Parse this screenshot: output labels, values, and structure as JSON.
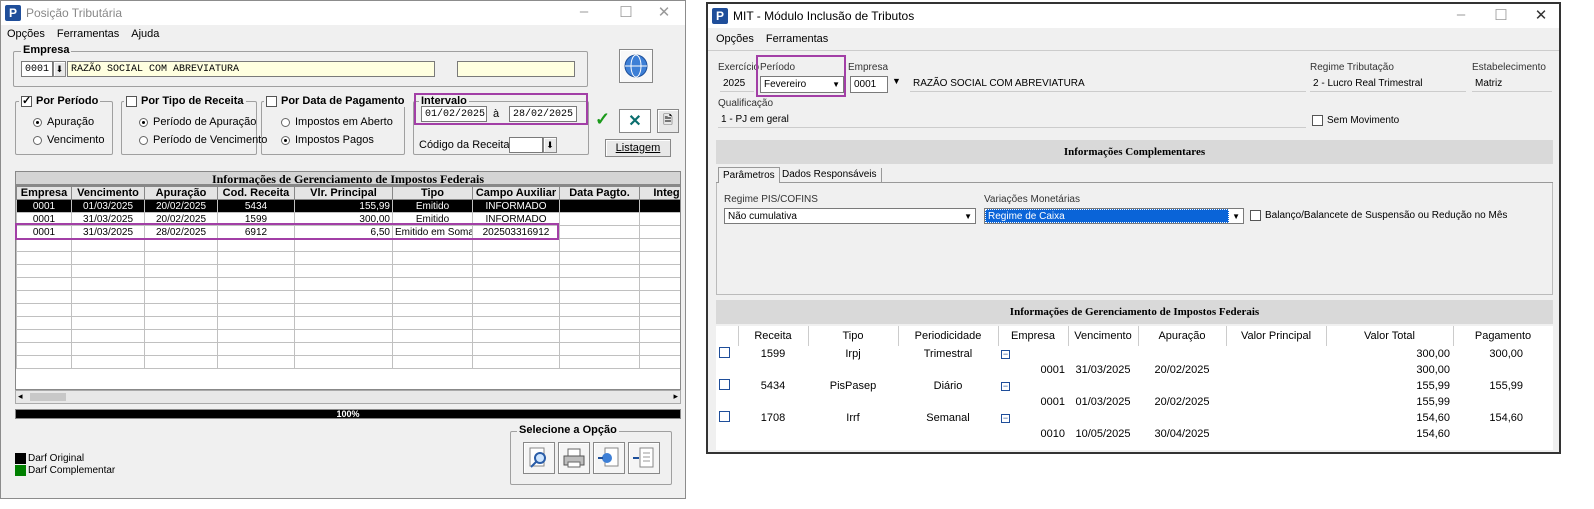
{
  "w1": {
    "title": "Posição Tributária",
    "menu": [
      "Opções",
      "Ferramentas",
      "Ajuda"
    ],
    "empresa_label": "Empresa",
    "empresa_code": "0001",
    "empresa_name": "RAZÃO SOCIAL COM ABREVIATURA",
    "periodo": {
      "label": "Por Período",
      "opt1": "Apuração",
      "opt2": "Vencimento"
    },
    "tipo": {
      "label": "Por Tipo de Receita",
      "opt1": "Período de Apuração",
      "opt2": "Período de Vencimento"
    },
    "data_pag": {
      "label": "Por Data de Pagamento",
      "opt1": "Impostos em Aberto",
      "opt2": "Impostos Pagos"
    },
    "intervalo": {
      "label": "Intervalo",
      "from": "01/02/2025",
      "sep": "à",
      "to": "28/02/2025"
    },
    "codigo_label": "Código da Receita:",
    "listagem": "Listagem",
    "grid_title": "Informações de Gerenciamento de Impostos Federais",
    "columns": [
      "Empresa",
      "Vencimento",
      "Apuração",
      "Cod. Receita",
      "Vlr. Principal",
      "Tipo",
      "Campo Auxiliar",
      "Data Pagto.",
      "Integ."
    ],
    "rows": [
      [
        "0001",
        "01/03/2025",
        "20/02/2025",
        "5434",
        "155,99",
        "Emitido",
        "INFORMADO",
        "",
        ""
      ],
      [
        "0001",
        "31/03/2025",
        "20/02/2025",
        "1599",
        "300,00",
        "Emitido",
        "INFORMADO",
        "",
        ""
      ],
      [
        "0001",
        "31/03/2025",
        "28/02/2025",
        "6912",
        "6,50",
        "Emitido em Soma",
        "202503316912",
        "",
        ""
      ]
    ],
    "progress_label": "100%",
    "progress": 1.0,
    "legend": [
      {
        "label": "Darf Original",
        "color": "#000000"
      },
      {
        "label": "Darf Complementar",
        "color": "#008000"
      }
    ],
    "selecione": "Selecione a Opção"
  },
  "w2": {
    "title": "MIT - Módulo Inclusão de Tributos",
    "menu": [
      "Opções",
      "Ferramentas"
    ],
    "exercicio_label": "Exercício",
    "exercicio": "2025",
    "periodo_label": "Período",
    "periodo": "Fevereiro",
    "empresa_label": "Empresa",
    "empresa_code": "0001",
    "empresa_name": "RAZÃO SOCIAL COM ABREVIATURA",
    "regime_label": "Regime Tributação",
    "regime": "2 - Lucro Real Trimestral",
    "estab_label": "Estabelecimento",
    "estab": "Matriz",
    "qualif_label": "Qualificação",
    "qualif": "1 - PJ em geral",
    "sem_mov": "Sem Movimento",
    "info_comp": "Informações Complementares",
    "tabs": [
      "Parâmetros",
      "Dados Responsáveis"
    ],
    "pis_label": "Regime PIS/COFINS",
    "pis": "Não cumulativa",
    "var_label": "Variações Monetárias",
    "var": "Regime de Caixa",
    "balanco": "Balanço/Balancete de Suspensão ou Redução no Mês",
    "grid_title": "Informações de Gerenciamento de Impostos Federais",
    "columns": [
      "Receita",
      "Tipo",
      "Periodicidade",
      "Empresa",
      "Vencimento",
      "Apuração",
      "Valor Principal",
      "Valor Total",
      "Pagamento"
    ],
    "groups": [
      {
        "receita": "1599",
        "tipo": "Irpj",
        "periodicidade": "Trimestral",
        "principal": "300,00",
        "total": "300,00",
        "empresa": "0001",
        "venc": "31/03/2025",
        "apur": "20/02/2025",
        "sub_principal": "300,00"
      },
      {
        "receita": "5434",
        "tipo": "PisPasep",
        "periodicidade": "Diário",
        "principal": "155,99",
        "total": "155,99",
        "empresa": "0001",
        "venc": "01/03/2025",
        "apur": "20/02/2025",
        "sub_principal": "155,99"
      },
      {
        "receita": "1708",
        "tipo": "Irrf",
        "periodicidade": "Semanal",
        "principal": "154,60",
        "total": "154,60",
        "empresa": "0010",
        "venc": "10/05/2025",
        "apur": "30/04/2025",
        "sub_principal": "154,60"
      }
    ]
  }
}
